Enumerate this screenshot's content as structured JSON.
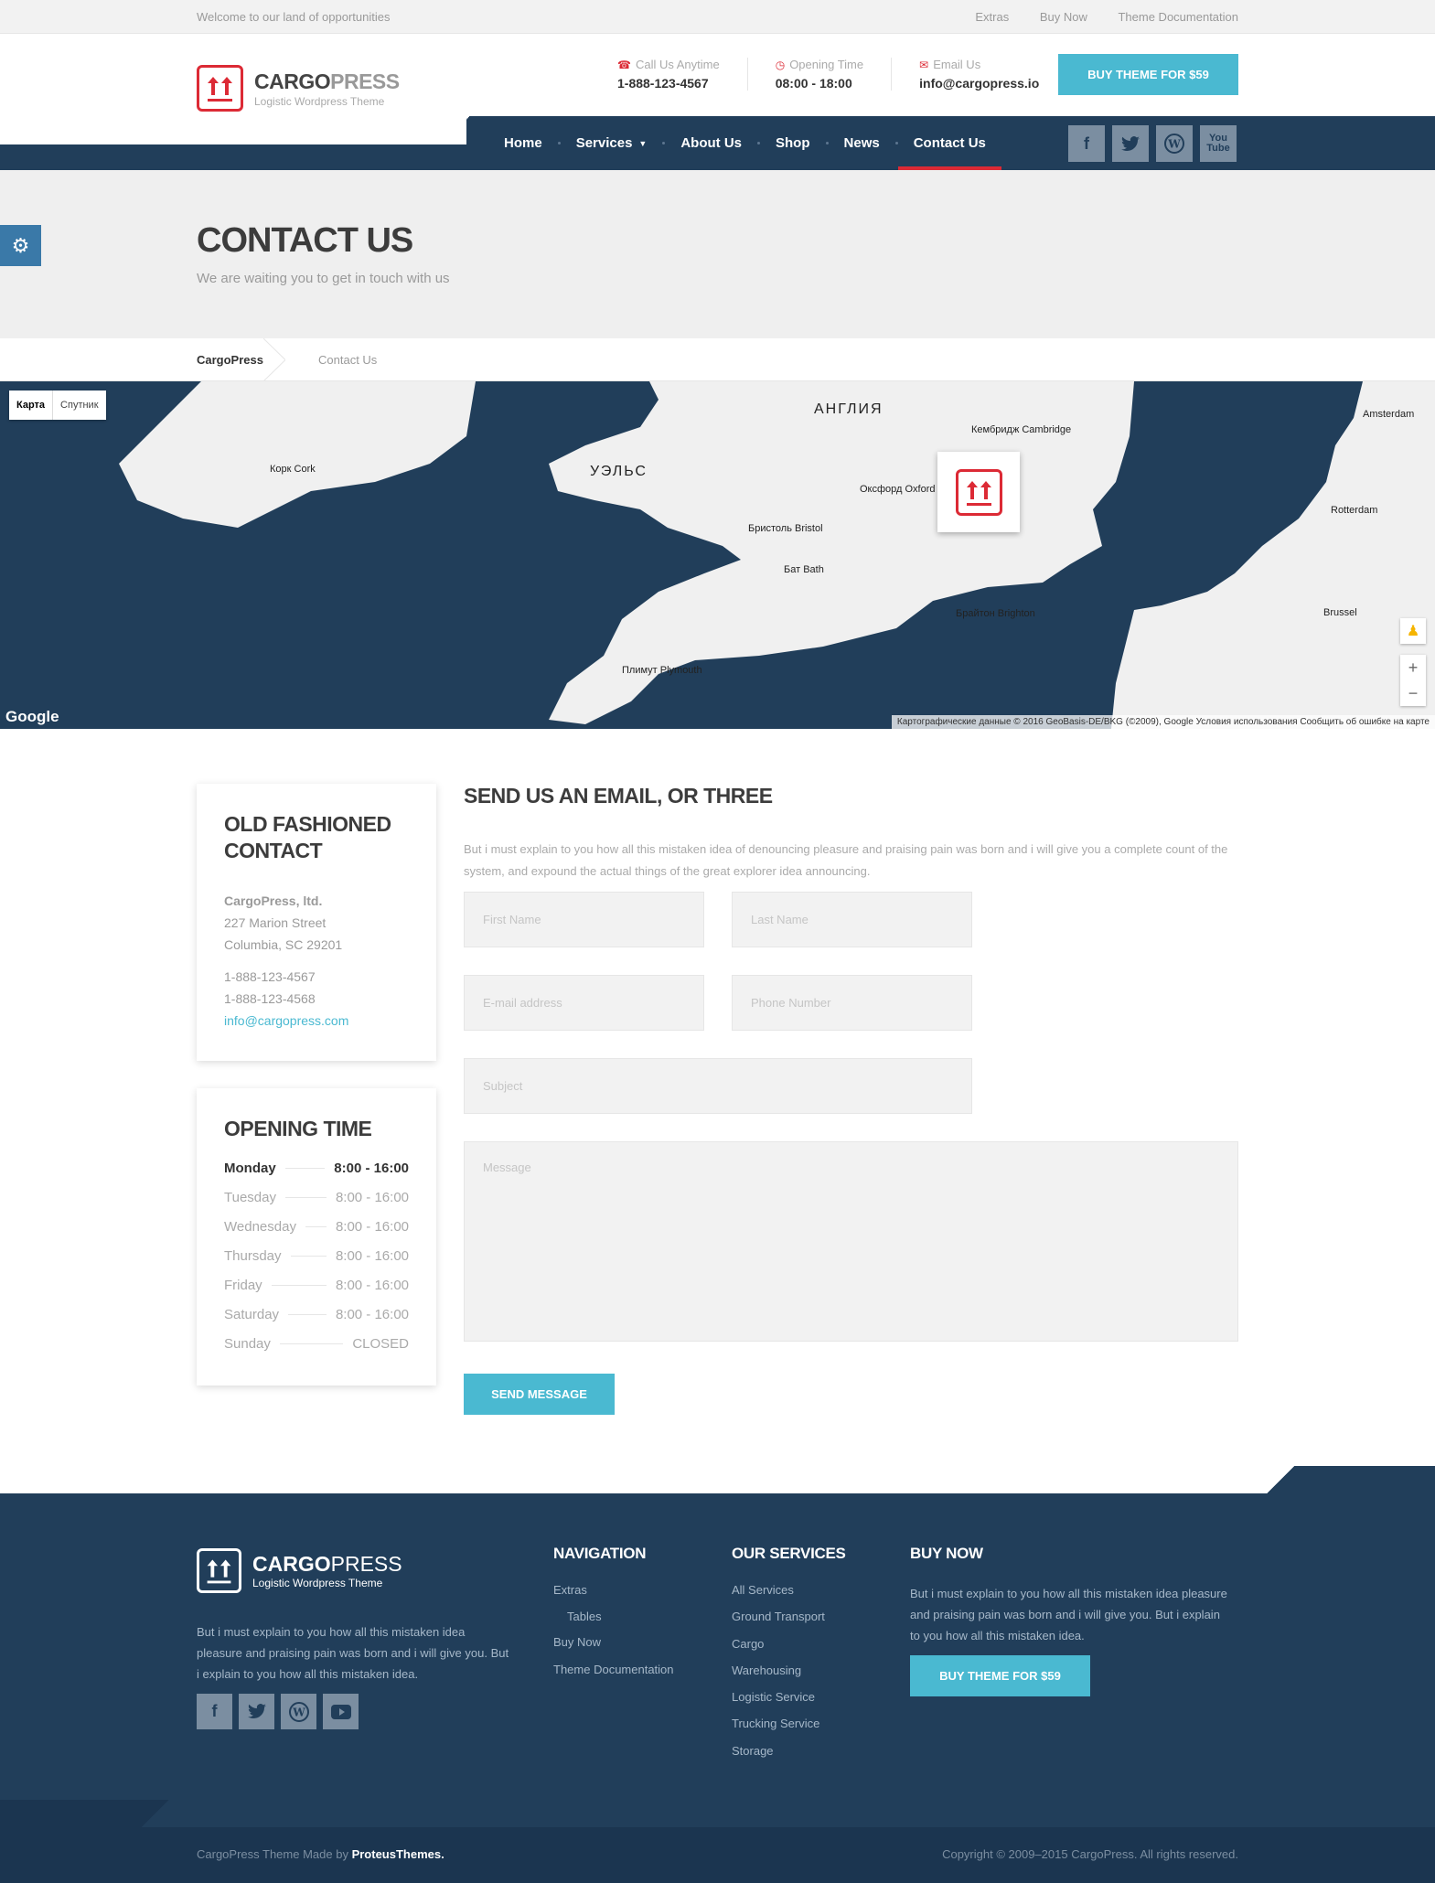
{
  "topbar": {
    "welcome": "Welcome to our land of opportunities",
    "links": [
      "Extras",
      "Buy Now",
      "Theme Documentation"
    ]
  },
  "logo": {
    "brand_bold": "CARGO",
    "brand_light": "PRESS",
    "tagline": "Logistic Wordpress Theme"
  },
  "header_info": [
    {
      "label": "Call Us Anytime",
      "value": "1-888-123-4567",
      "icon": "headset-icon"
    },
    {
      "label": "Opening Time",
      "value": "08:00 - 18:00",
      "icon": "clock-icon"
    },
    {
      "label": "Email Us",
      "value": "info@cargopress.io",
      "icon": "envelope-icon"
    }
  ],
  "buy_button": "BUY THEME FOR $59",
  "nav": {
    "items": [
      "Home",
      "Services",
      "About Us",
      "Shop",
      "News",
      "Contact Us"
    ],
    "active": "Contact Us"
  },
  "socials": [
    "facebook-icon",
    "twitter-icon",
    "wordpress-icon",
    "youtube-icon"
  ],
  "hero": {
    "title": "CONTACT US",
    "subtitle": "We are waiting you to get in touch with us"
  },
  "breadcrumbs": [
    "CargoPress",
    "Contact Us"
  ],
  "map": {
    "types": [
      "Карта",
      "Спутник"
    ],
    "google": "Google",
    "footer": "Картографические данные © 2016 GeoBasis-DE/BKG (©2009), Google   Условия использования   Сообщить об ошибке на карте",
    "labels": [
      {
        "text": "АНГЛИЯ",
        "big": true
      },
      {
        "text": "УЭЛЬС",
        "big": true
      },
      {
        "text": "Кембридж Cambridge"
      },
      {
        "text": "Оксфорд Oxford"
      },
      {
        "text": "Бристоль Bristol"
      },
      {
        "text": "Бат Bath"
      },
      {
        "text": "Брайтон Brighton"
      },
      {
        "text": "Плимут Plymouth"
      },
      {
        "text": "Корк Cork"
      },
      {
        "text": "Rotterdam"
      },
      {
        "text": "Amsterdam"
      },
      {
        "text": "Brussel"
      }
    ]
  },
  "address_card": {
    "title": "OLD FASHIONED CONTACT",
    "company": "CargoPress, ltd.",
    "street": "227 Marion Street",
    "city": "Columbia, SC 29201",
    "phone1": "1-888-123-4567",
    "phone2": "1-888-123-4568",
    "email": "info@cargopress.com"
  },
  "hours_card": {
    "title": "OPENING TIME",
    "rows": [
      {
        "day": "Monday",
        "time": "8:00 - 16:00"
      },
      {
        "day": "Tuesday",
        "time": "8:00 - 16:00"
      },
      {
        "day": "Wednesday",
        "time": "8:00 - 16:00"
      },
      {
        "day": "Thursday",
        "time": "8:00 - 16:00"
      },
      {
        "day": "Friday",
        "time": "8:00 - 16:00"
      },
      {
        "day": "Saturday",
        "time": "8:00 - 16:00"
      },
      {
        "day": "Sunday",
        "time": "CLOSED"
      }
    ]
  },
  "form": {
    "title": "SEND US AN EMAIL, OR THREE",
    "description": "But i must explain to you how all this mistaken idea of denouncing pleasure and praising pain was born and i will give you a complete count of the system, and expound the actual things of the great explorer idea announcing.",
    "first_name": "First Name",
    "last_name": "Last Name",
    "email": "E-mail address",
    "phone": "Phone Number",
    "subject": "Subject",
    "message": "Message",
    "submit": "SEND MESSAGE"
  },
  "footer": {
    "brand_bold": "CARGO",
    "brand_light": "PRESS",
    "tagline": "Logistic Wordpress Theme",
    "about": "But i must explain to you how all this mistaken idea pleasure and praising pain was born and i will give you. But i explain to you how all this mistaken idea.",
    "nav_title": "NAVIGATION",
    "nav_items": [
      "Extras",
      "Tables",
      "Buy Now",
      "Theme Documentation"
    ],
    "services_title": "OUR SERVICES",
    "services": [
      "All Services",
      "Ground Transport",
      "Cargo",
      "Warehousing",
      "Logistic Service",
      "Trucking Service",
      "Storage"
    ],
    "buy_title": "BUY NOW",
    "buy_text": "But i must explain to you how all this mistaken idea pleasure and praising pain was born and i will give you. But i explain to you how all this mistaken idea.",
    "buy_button": "BUY THEME FOR $59",
    "made_by": "CargoPress Theme Made by",
    "made_by_link": "ProteusThemes.",
    "copyright": "Copyright © 2009–2015 CargoPress. All rights reserved."
  }
}
